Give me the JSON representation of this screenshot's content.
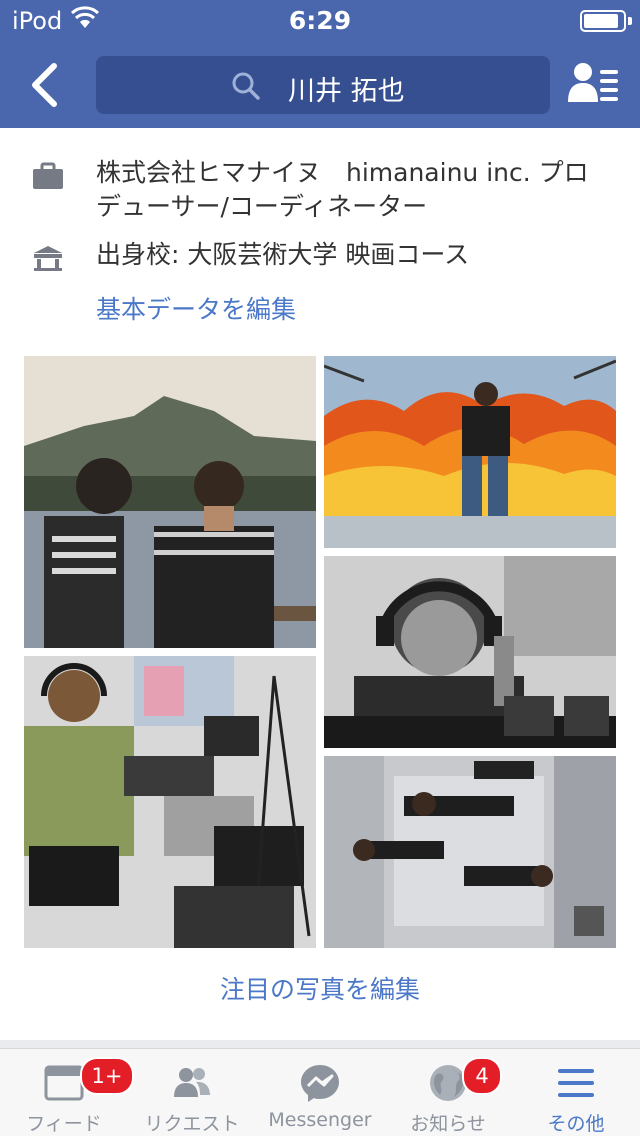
{
  "status_bar": {
    "carrier": "iPod",
    "time": "6:29"
  },
  "nav": {
    "search_value": "川井 拓也"
  },
  "info": {
    "work": "株式会社ヒマナイヌ　himanainu inc. プロデューサー/コーディネーター",
    "education": "出身校: 大阪芸術大学 映画コース",
    "edit_basic_link": "基本データを編集"
  },
  "photos": {
    "edit_featured_link": "注目の写真を編集"
  },
  "tabbar": {
    "tabs": [
      {
        "label": "フィード",
        "badge": "1+"
      },
      {
        "label": "リクエスト"
      },
      {
        "label": "Messenger"
      },
      {
        "label": "お知らせ",
        "badge": "4"
      },
      {
        "label": "その他",
        "active": true
      }
    ]
  },
  "colors": {
    "header_bg": "#4a67ad",
    "search_bg": "#364f91",
    "link": "#4b78c8",
    "badge": "#e41e26"
  }
}
